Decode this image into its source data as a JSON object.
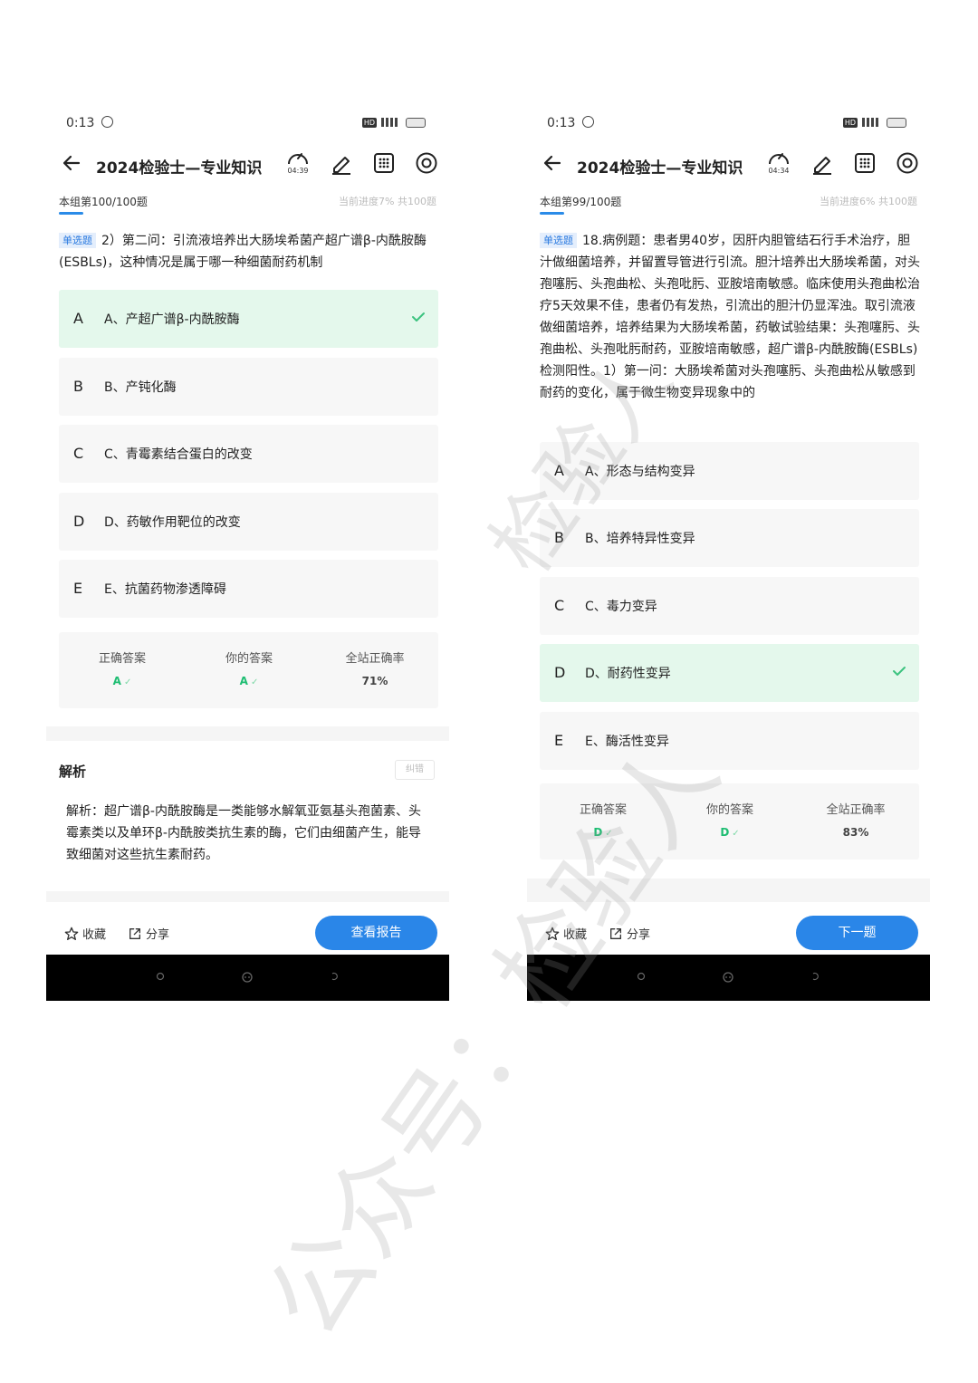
{
  "screens": [
    {
      "status": {
        "time": "0:13",
        "hd": "HD"
      },
      "nav": {
        "title": "2024检验士—专业知识",
        "timer": "04:39"
      },
      "progress": {
        "group": "本组第100/100题",
        "info": "当前进度7% 共100题"
      },
      "question": {
        "type": "单选题",
        "text": "2）第二问：引流液培养出大肠埃希菌产超广谱β-内酰胺酶(ESBLs)，这种情况是属于哪一种细菌耐药机制"
      },
      "options": [
        {
          "letter": "A",
          "text": "A、产超广谱β-内酰胺酶",
          "correct": true
        },
        {
          "letter": "B",
          "text": "B、产钝化酶",
          "correct": false
        },
        {
          "letter": "C",
          "text": "C、青霉素结合蛋白的改变",
          "correct": false
        },
        {
          "letter": "D",
          "text": "D、药敏作用靶位的改变",
          "correct": false
        },
        {
          "letter": "E",
          "text": "E、抗菌药物渗透障碍",
          "correct": false
        }
      ],
      "stats": {
        "correct_label": "正确答案",
        "correct_value": "A",
        "yours_label": "你的答案",
        "yours_value": "A",
        "rate_label": "全站正确率",
        "rate_value": "71%"
      },
      "analysis": {
        "title": "解析",
        "report_error": "纠错",
        "text": "解析：超广谱β-内酰胺酶是一类能够水解氧亚氨基头孢菌素、头霉素类以及单环β-内酰胺类抗生素的酶，它们由细菌产生，能导致细菌对这些抗生素耐药。"
      },
      "bottom": {
        "favorite": "收藏",
        "share": "分享",
        "primary": "查看报告"
      }
    },
    {
      "status": {
        "time": "0:13",
        "hd": "HD"
      },
      "nav": {
        "title": "2024检验士—专业知识",
        "timer": "04:34"
      },
      "progress": {
        "group": "本组第99/100题",
        "info": "当前进度6% 共100题"
      },
      "question": {
        "type": "单选题",
        "text": "18.病例题：患者男40岁，因肝内胆管结石行手术治疗，胆汁做细菌培养，并留置导管进行引流。胆汁培养出大肠埃希菌，对头孢噻肟、头孢曲松、头孢吡肟、亚胺培南敏感。临床使用头孢曲松治疗5天效果不佳，患者仍有发热，引流出的胆汁仍显浑浊。取引流液做细菌培养，培养结果为大肠埃希菌，药敏试验结果：头孢噻肟、头孢曲松、头孢吡肟耐药，亚胺培南敏感，超广谱β-内酰胺酶(ESBLs)检测阳性。1）第一问：大肠埃希菌对头孢噻肟、头孢曲松从敏感到耐药的变化，属于微生物变异现象中的"
      },
      "options": [
        {
          "letter": "A",
          "text": "A、形态与结构变异",
          "correct": false
        },
        {
          "letter": "B",
          "text": "B、培养特异性变异",
          "correct": false
        },
        {
          "letter": "C",
          "text": "C、毒力变异",
          "correct": false
        },
        {
          "letter": "D",
          "text": "D、耐药性变异",
          "correct": true
        },
        {
          "letter": "E",
          "text": "E、酶活性变异",
          "correct": false
        }
      ],
      "stats": {
        "correct_label": "正确答案",
        "correct_value": "D",
        "yours_label": "你的答案",
        "yours_value": "D",
        "rate_label": "全站正确率",
        "rate_value": "83%"
      },
      "bottom": {
        "favorite": "收藏",
        "share": "分享",
        "primary": "下一题"
      }
    }
  ],
  "watermark": {
    "main": "公众号：检验人",
    "secondary": "检验人"
  },
  "colors": {
    "accent_blue": "#2a86e8",
    "correct_green": "#1ebd72",
    "correct_bg": "#e4f8ec"
  }
}
